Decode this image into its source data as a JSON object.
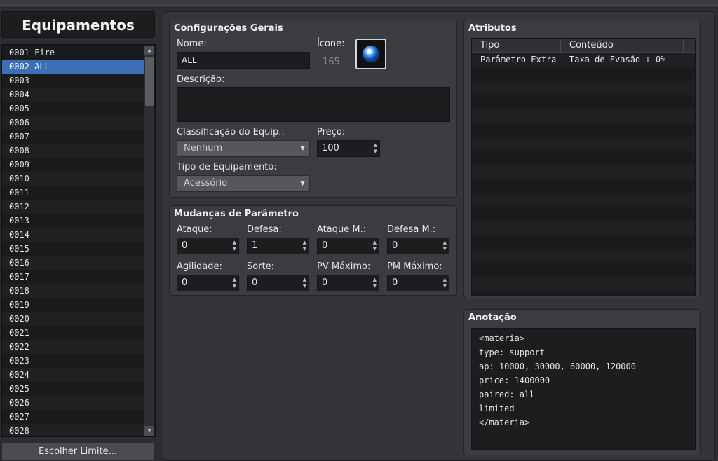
{
  "left": {
    "title": "Equipamentos",
    "items": [
      "0001 Fire",
      "0002 ALL",
      "0003",
      "0004",
      "0005",
      "0006",
      "0007",
      "0008",
      "0009",
      "0010",
      "0011",
      "0012",
      "0013",
      "0014",
      "0015",
      "0016",
      "0017",
      "0018",
      "0019",
      "0020",
      "0021",
      "0022",
      "0023",
      "0024",
      "0025",
      "0026",
      "0027",
      "0028"
    ],
    "selected_index": 1,
    "limit_button": "Escolher Limite..."
  },
  "general": {
    "title": "Configurações Gerais",
    "name_label": "Nome:",
    "name_value": "ALL",
    "icon_label": "Ícone:",
    "icon_index": "165",
    "desc_label": "Descrição:",
    "desc_value": "",
    "class_label": "Classificação do Equip.:",
    "class_value": "Nenhum",
    "price_label": "Preço:",
    "price_value": "100",
    "type_label": "Tipo de Equipamento:",
    "type_value": "Acessório"
  },
  "params": {
    "title": "Mudanças de Parâmetro",
    "items": [
      {
        "label": "Ataque:",
        "value": "0"
      },
      {
        "label": "Defesa:",
        "value": "1"
      },
      {
        "label": "Ataque M.:",
        "value": "0"
      },
      {
        "label": "Defesa M.:",
        "value": "0"
      },
      {
        "label": "Agilidade:",
        "value": "0"
      },
      {
        "label": "Sorte:",
        "value": "0"
      },
      {
        "label": "PV Máximo:",
        "value": "0"
      },
      {
        "label": "PM Máximo:",
        "value": "0"
      }
    ]
  },
  "attributes": {
    "title": "Atributos",
    "col_type": "Tipo",
    "col_content": "Conteúdo",
    "rows": [
      {
        "type": "Parâmetro Extra",
        "content": "Taxa de Evasão + 0%"
      }
    ]
  },
  "note": {
    "title": "Anotação",
    "lines": [
      "<materia>",
      "type: support",
      "ap: 10000, 30000, 60000, 120000",
      "price: 1400000",
      "paired: all",
      "limited",
      "</materia>"
    ]
  },
  "colors": {
    "selection": "#3d6fb6",
    "panel": "#3a3c40",
    "field": "#1c1d1f"
  },
  "icons": {
    "icon_preview": "blue-orb-icon",
    "spin": "up-down-arrows-icon",
    "combo": "chevron-down-icon"
  }
}
